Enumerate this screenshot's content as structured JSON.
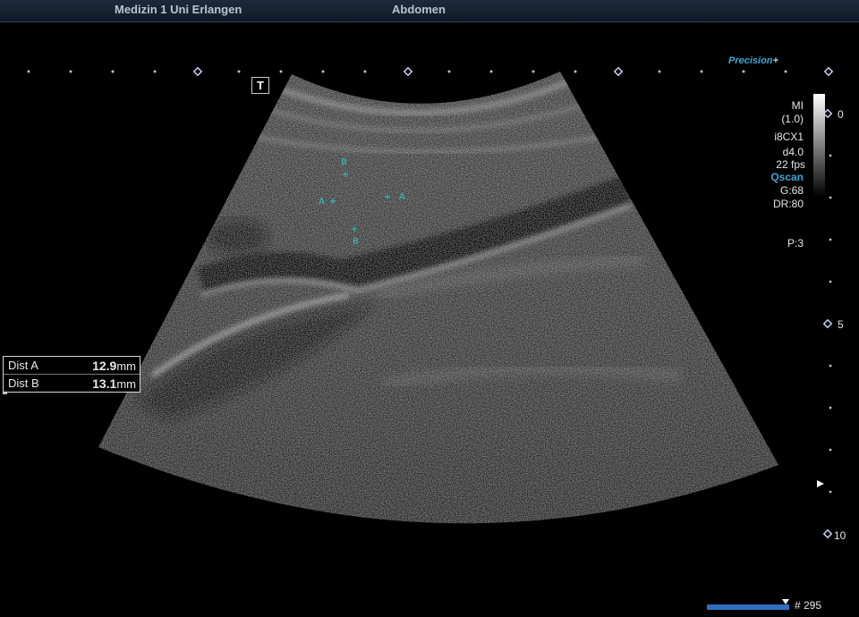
{
  "header": {
    "institution": "Medizin 1 Uni Erlangen",
    "exam": "Abdomen"
  },
  "right_panel": {
    "mi_label": "MI",
    "mi_value": "(1.0)",
    "probe": "i8CX1",
    "depth": "d4.0",
    "frame_rate": "22 fps",
    "qscan": "Qscan",
    "gain": "G:68",
    "dynamic_range": "DR:80",
    "power": "P:3"
  },
  "depth_scale": {
    "labels": [
      "0",
      "5",
      "10"
    ]
  },
  "precision_label": "Precision",
  "t_marker": "T",
  "measurements": [
    {
      "label": "Dist A",
      "value": "12.9",
      "unit": "mm"
    },
    {
      "label": "Dist B",
      "value": "13.1",
      "unit": "mm"
    }
  ],
  "calipers": {
    "a_label": "A",
    "b_label": "B"
  },
  "cine": {
    "frame": "# 295"
  },
  "colors": {
    "caliper": "#25c8c4",
    "accent": "#3fa6d0",
    "header_bg": "#14202f"
  }
}
